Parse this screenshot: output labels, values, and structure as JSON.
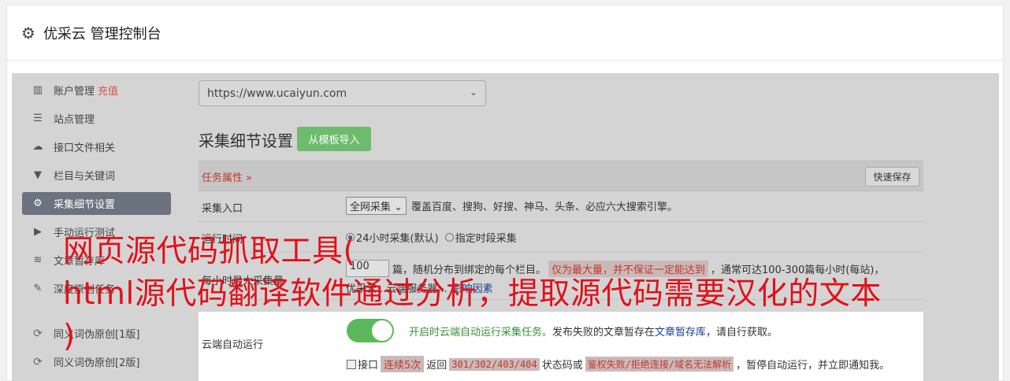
{
  "header": {
    "title": "优采云 管理控制台",
    "icon": "gear-icon"
  },
  "sidebar": {
    "items": [
      {
        "label": "账户管理",
        "extra": "充值",
        "icon": "bar-chart-icon"
      },
      {
        "label": "站点管理",
        "icon": "server-icon"
      },
      {
        "label": "接口文件相关",
        "icon": "cloud-upload-icon"
      },
      {
        "label": "栏目与关键词",
        "icon": "filter-icon"
      },
      {
        "label": "采集细节设置",
        "icon": "gears-icon",
        "active": true
      },
      {
        "label": "手动运行测试",
        "icon": "play-circle-icon"
      },
      {
        "label": "文章暂存库",
        "icon": "database-icon"
      },
      {
        "label": "深度原创任务",
        "icon": "edit-icon"
      },
      {
        "label": "同义词伪原创[1版]",
        "icon": "refresh-icon"
      },
      {
        "label": "同义词伪原创[2版]",
        "icon": "refresh-icon"
      }
    ]
  },
  "main": {
    "site_select": "https://www.ucaiyun.com",
    "section_title": "采集细节设置",
    "import_button": "从模板导入",
    "task_attr": "任务属性 »",
    "quick_save": "快速保存",
    "rows": {
      "entry": {
        "label": "采集入口",
        "select": "全网采集",
        "text": "覆盖百度、搜狗、好搜、神马、头条、必应六大搜索引擎。"
      },
      "run_time": {
        "label": "运行时间",
        "option1": "24小时采集(默认)",
        "option2": "指定时段采集"
      },
      "max_per_hour": {
        "label": "每小时最大采集量",
        "value": "100",
        "text1": "篇，随机分布到绑定的每个栏目。",
        "tag": "仅为最大量，并不保证一定能达到",
        "text2": "，通常可达100-300篇每小时(每站)，",
        "line2": "优采云...云端服务器...",
        "link": "影响因素"
      },
      "cloud": {
        "label": "云端自动运行",
        "desc1": "开启时云端自动运行采集任务。",
        "desc2": "发布失败的文章暂存在",
        "link": "文章暂存库",
        "desc3": "，请自行获取。",
        "cb_text": "接口",
        "tag1": "连续5次",
        "t2": "返回",
        "code": "301/302/403/404",
        "t3": "状态码或",
        "code2": "鉴权失败/拒绝连接/域名无法解析",
        "t4": "，暂停自动运行，并立即通知我。"
      }
    }
  },
  "overlay": {
    "line1": "网页源代码抓取工具(",
    "line2": "html源代码翻译软件通过分析，提取源代码需要汉化的文本",
    "line3": ")"
  }
}
